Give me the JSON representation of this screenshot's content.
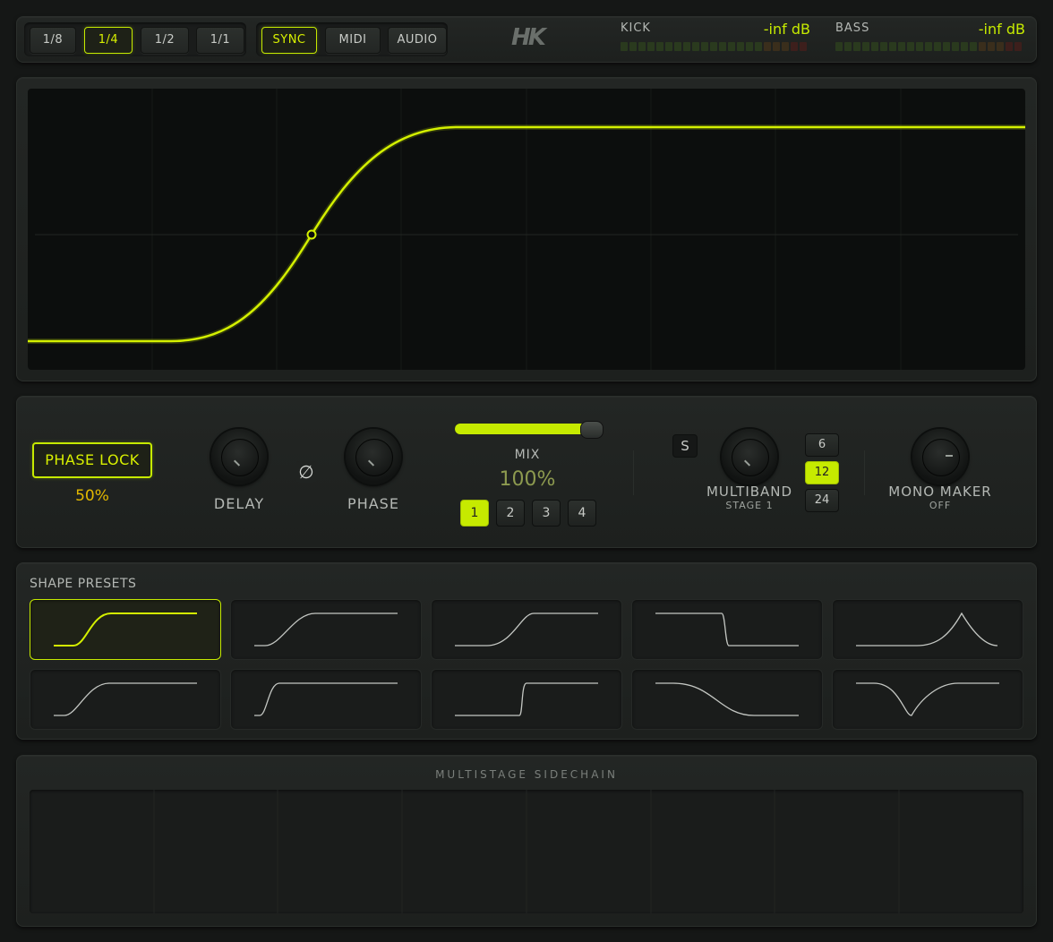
{
  "topbar": {
    "rate_buttons": [
      {
        "label": "1/8",
        "active": false
      },
      {
        "label": "1/4",
        "active": true
      },
      {
        "label": "1/2",
        "active": false
      },
      {
        "label": "1/1",
        "active": false
      }
    ],
    "mode_buttons": [
      {
        "label": "SYNC",
        "active": true
      },
      {
        "label": "MIDI",
        "active": false
      },
      {
        "label": "AUDIO",
        "active": false
      }
    ],
    "logo": "HK",
    "meters": [
      {
        "name": "KICK",
        "value": "-inf dB"
      },
      {
        "name": "BASS",
        "value": "-inf dB"
      }
    ]
  },
  "controls": {
    "phase_lock": {
      "label": "PHASE LOCK",
      "value": "50%"
    },
    "delay": {
      "label": "DELAY"
    },
    "phase_invert_icon": "∅",
    "phase": {
      "label": "PHASE"
    },
    "mix": {
      "label": "MIX",
      "value": "100%",
      "level": 1.0
    },
    "stages": [
      "1",
      "2",
      "3",
      "4"
    ],
    "active_stage": "1",
    "solo_label": "S",
    "multiband": {
      "label": "MULTIBAND",
      "sub": "STAGE 1",
      "slopes": [
        "6",
        "12",
        "24"
      ],
      "active_slope": "12"
    },
    "mono_maker": {
      "label": "MONO MAKER",
      "sub": "OFF"
    }
  },
  "presets": {
    "title": "SHAPE PRESETS",
    "items": [
      "smooth-rise",
      "soft-rise",
      "late-rise",
      "drop",
      "peak",
      "steep-rise",
      "fast-rise",
      "step-rise",
      "fall",
      "dip"
    ],
    "active_index": 0
  },
  "multistage": {
    "title": "MULTISTAGE SIDECHAIN"
  },
  "colors": {
    "accent": "#c6ea00",
    "bg": "#151716",
    "panel": "#202321"
  }
}
